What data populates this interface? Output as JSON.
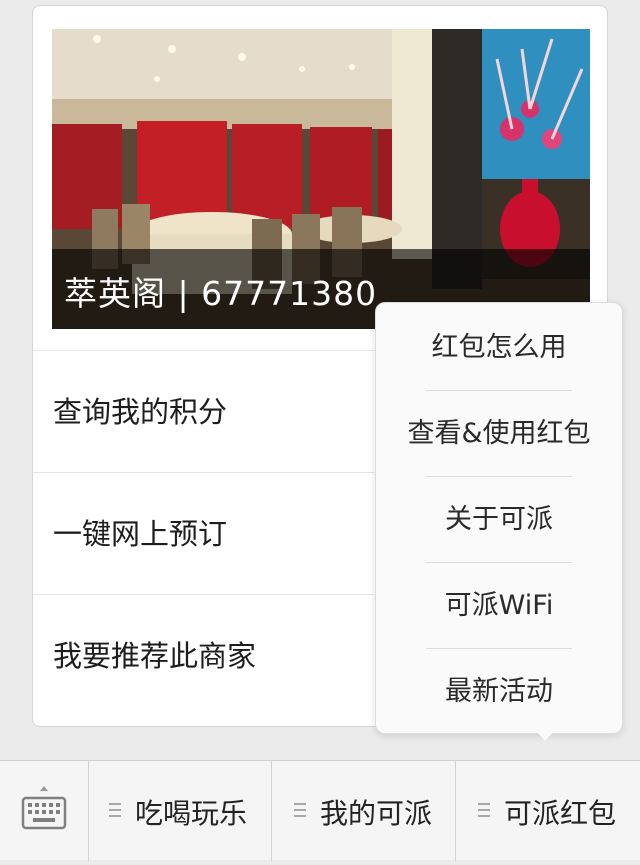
{
  "banner": {
    "caption": "萃英阁 | 67771380"
  },
  "card_menu": {
    "items": [
      {
        "label": "查询我的积分"
      },
      {
        "label": "一键网上预订"
      },
      {
        "label": "我要推荐此商家"
      }
    ]
  },
  "popup_menu": {
    "items": [
      {
        "label": "红包怎么用"
      },
      {
        "label": "查看&使用红包"
      },
      {
        "label": "关于可派"
      },
      {
        "label": "可派WiFi"
      },
      {
        "label": "最新活动"
      }
    ]
  },
  "bottom_bar": {
    "keyboard_icon": "keyboard-icon",
    "tabs": [
      {
        "label": "吃喝玩乐",
        "icon": "menu-lines-icon"
      },
      {
        "label": "我的可派",
        "icon": "menu-lines-icon"
      },
      {
        "label": "可派红包",
        "icon": "menu-lines-icon"
      }
    ]
  }
}
